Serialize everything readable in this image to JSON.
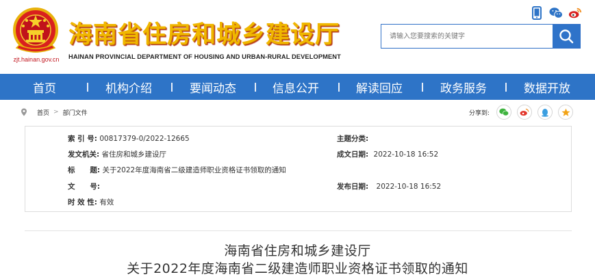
{
  "header": {
    "domain": "zjt.hainan.gov.cn",
    "title": "海南省住房和城乡建设厅",
    "subtitle": "HAINAN PROVINCIAL DEPARTMENT OF HOUSING AND URBAN-RURAL DEVELOPMENT",
    "icons": [
      "mobile-icon",
      "wechat-icon",
      "weibo-icon"
    ],
    "search": {
      "placeholder": "请输入您要搜索的关键字",
      "button_icon": "search-icon"
    }
  },
  "nav": {
    "items": [
      "首页",
      "机构介绍",
      "要闻动态",
      "信息公开",
      "解读回应",
      "政务服务",
      "数据开放"
    ]
  },
  "breadcrumb": {
    "items": [
      "首页",
      "部门文件"
    ],
    "separator": ">",
    "share_label": "分享到:",
    "share_icons": [
      "wechat-icon",
      "weibo-icon",
      "qq-icon",
      "favorite-icon"
    ]
  },
  "meta": {
    "index_key": "索 引 号:",
    "index_val": "00817379-0/2022-12665",
    "topic_key": "主题分类:",
    "topic_val": "",
    "issuer_key": "发文机关:",
    "issuer_val": "省住房和城乡建设厅",
    "created_key": "成文日期:",
    "created_val": "2022-10-18 16:52",
    "title_key": "标      题:",
    "title_val": "关于2022年度海南省二级建造师职业资格证书领取的通知",
    "docno_key": "文      号:",
    "docno_val": "",
    "published_key": "发布日期:",
    "published_val": "2022-10-18 16:52",
    "validity_key": "时 效 性:",
    "validity_val": "有效"
  },
  "document": {
    "org": "海南省住房和城乡建设厅",
    "title": "关于2022年度海南省二级建造师职业资格证书领取的通知"
  },
  "colors": {
    "brand_blue": "#2e74c7",
    "title_gold": "#f0b700",
    "emblem_red": "#c1121b"
  }
}
